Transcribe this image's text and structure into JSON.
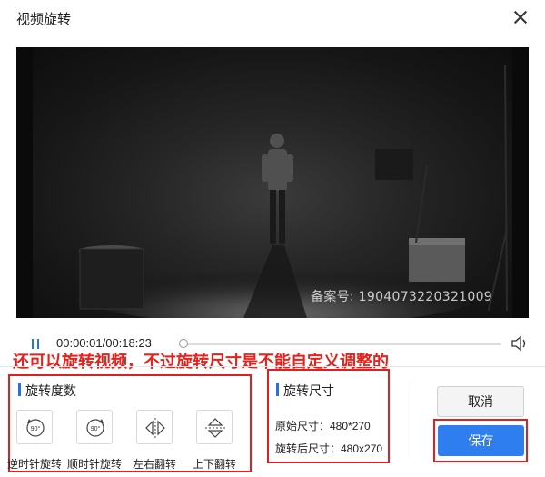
{
  "window": {
    "title": "视频旋转"
  },
  "player": {
    "watermark": "备案号: 1904073220321009",
    "time": "00:00:01/00:18:23",
    "progress": 0.001,
    "icons": {
      "pause": "pause-icon",
      "volume": "speaker-icon"
    }
  },
  "annotation": {
    "text": "还可以旋转视频，不过旋转尺寸是不能自定义调整的",
    "color": "#e8211c"
  },
  "rotation": {
    "title": "旋转度数",
    "buttons": [
      {
        "label": "逆时针旋转",
        "icon_text": "90°"
      },
      {
        "label": "顺时针旋转",
        "icon_text": "90°"
      },
      {
        "label": "左右翻转"
      },
      {
        "label": "上下翻转"
      }
    ]
  },
  "size": {
    "title": "旋转尺寸",
    "original": "原始尺寸：480*270",
    "rotated": "旋转后尺寸：480x270"
  },
  "actions": {
    "cancel": "取消",
    "save": "保存"
  },
  "colors": {
    "accent": "#2f7ef0",
    "highlight_box": "#e02020"
  }
}
